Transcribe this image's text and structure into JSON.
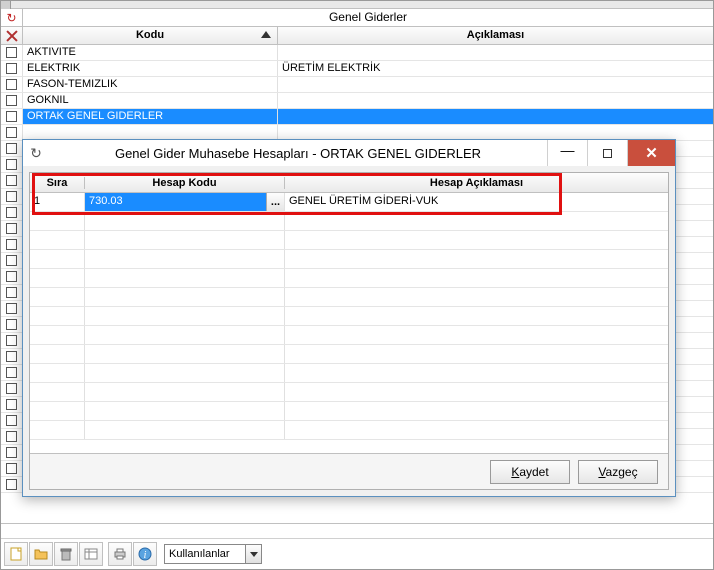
{
  "main": {
    "title": "Genel Giderler",
    "columns": {
      "kodu": "Kodu",
      "aciklamasi": "Açıklaması"
    },
    "rows": [
      {
        "kodu": "AKTIVITE",
        "acik": ""
      },
      {
        "kodu": "ELEKTRIK",
        "acik": "ÜRETİM ELEKTRİK"
      },
      {
        "kodu": "FASON-TEMIZLIK",
        "acik": ""
      },
      {
        "kodu": "GOKNIL",
        "acik": ""
      },
      {
        "kodu": "ORTAK GENEL GIDERLER",
        "acik": ""
      }
    ]
  },
  "dialog": {
    "title": "Genel Gider Muhasebe Hesapları - ORTAK GENEL GIDERLER",
    "columns": {
      "sira": "Sıra",
      "hesap_kodu": "Hesap Kodu",
      "hesap_acik": "Hesap Açıklaması"
    },
    "rows": [
      {
        "sira": "1",
        "hesap_kodu": "730.03",
        "hesap_acik": "GENEL ÜRETİM GİDERİ-VUK"
      }
    ],
    "buttons": {
      "kaydet_u": "K",
      "kaydet_rest": "aydet",
      "vazgec_u": "V",
      "vazgec_rest": "azgeç"
    }
  },
  "toolbar": {
    "combo": "Kullanılanlar",
    "lookup_ellipsis": "..."
  }
}
